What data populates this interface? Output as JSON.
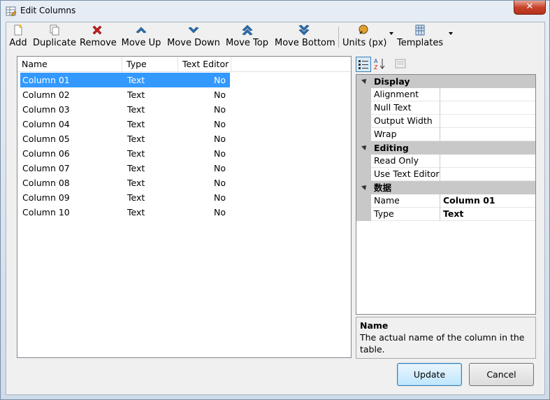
{
  "window": {
    "title": "Edit Columns",
    "close_label": "✕"
  },
  "toolbar": {
    "add": "Add",
    "duplicate": "Duplicate",
    "remove": "Remove",
    "move_up": "Move Up",
    "move_down": "Move Down",
    "move_top": "Move Top",
    "move_bottom": "Move Bottom",
    "units": "Units (px)",
    "templates": "Templates"
  },
  "grid": {
    "headers": {
      "name": "Name",
      "type": "Type",
      "editor": "Text Editor"
    },
    "rows": [
      {
        "name": "Column 01",
        "type": "Text",
        "editor": "No"
      },
      {
        "name": "Column 02",
        "type": "Text",
        "editor": "No"
      },
      {
        "name": "Column 03",
        "type": "Text",
        "editor": "No"
      },
      {
        "name": "Column 04",
        "type": "Text",
        "editor": "No"
      },
      {
        "name": "Column 05",
        "type": "Text",
        "editor": "No"
      },
      {
        "name": "Column 06",
        "type": "Text",
        "editor": "No"
      },
      {
        "name": "Column 07",
        "type": "Text",
        "editor": "No"
      },
      {
        "name": "Column 08",
        "type": "Text",
        "editor": "No"
      },
      {
        "name": "Column 09",
        "type": "Text",
        "editor": "No"
      },
      {
        "name": "Column 10",
        "type": "Text",
        "editor": "No"
      }
    ],
    "selected_index": 0
  },
  "property_grid": {
    "categories": [
      {
        "label": "Display",
        "props": [
          {
            "name": "Alignment",
            "value": ""
          },
          {
            "name": "Null Text",
            "value": ""
          },
          {
            "name": "Output Width",
            "value": ""
          },
          {
            "name": "Wrap",
            "value": ""
          }
        ]
      },
      {
        "label": "Editing",
        "props": [
          {
            "name": "Read Only",
            "value": ""
          },
          {
            "name": "Use Text Editor",
            "value": ""
          }
        ]
      },
      {
        "label": "数据",
        "props": [
          {
            "name": "Name",
            "value": "Column 01"
          },
          {
            "name": "Type",
            "value": "Text"
          }
        ]
      }
    ]
  },
  "description": {
    "title": "Name",
    "text": "The actual name of the column in the table."
  },
  "buttons": {
    "update": "Update",
    "cancel": "Cancel"
  },
  "colors": {
    "selection": "#3399ff",
    "category_bg": "#c8c8c8",
    "remove_icon": "#c81e1e",
    "arrow_icon": "#2a6fb0"
  }
}
